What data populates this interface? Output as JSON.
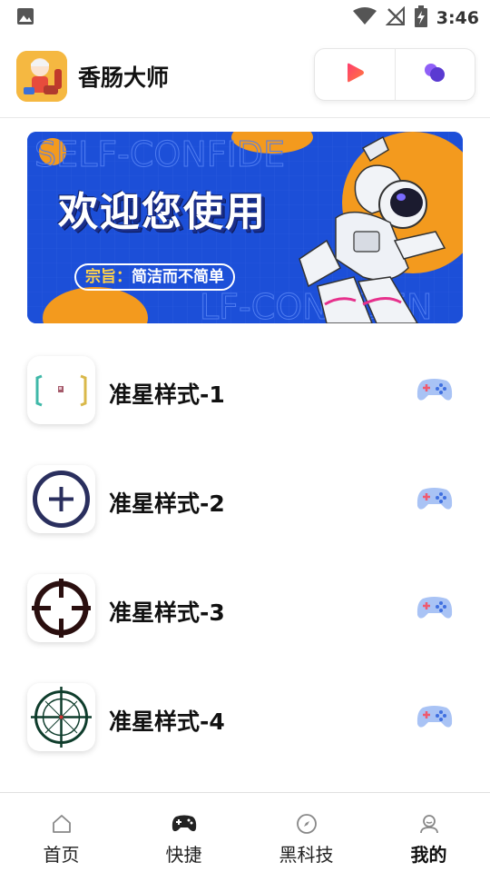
{
  "status_bar": {
    "time": "3:46",
    "icons": [
      "gallery-icon",
      "wifi-icon",
      "no-signal-icon",
      "battery-charging-icon"
    ]
  },
  "header": {
    "app_name": "香肠大师",
    "capsule_buttons": [
      "play-icon",
      "bubbles-icon"
    ]
  },
  "banner": {
    "title": "欢迎您使用",
    "subtitle_key": "宗旨：",
    "subtitle_value": "简洁而不简单",
    "background_text": "SELF-CONFIDENT",
    "colors": {
      "background": "#1c4fd8",
      "accent": "#f39a1e"
    }
  },
  "list": {
    "items": [
      {
        "label": "准星样式-1",
        "icon": "bracket-crosshair-icon"
      },
      {
        "label": "准星样式-2",
        "icon": "circle-plus-crosshair-icon"
      },
      {
        "label": "准星样式-3",
        "icon": "circle-scope-crosshair-icon"
      },
      {
        "label": "准星样式-4",
        "icon": "sniper-crosshair-icon"
      }
    ],
    "action_icon": "gamepad-icon"
  },
  "bottom_nav": {
    "items": [
      {
        "label": "首页",
        "icon": "home-icon",
        "active": false
      },
      {
        "label": "快捷",
        "icon": "gamepad-filled-icon",
        "active": false
      },
      {
        "label": "黑科技",
        "icon": "compass-icon",
        "active": false
      },
      {
        "label": "我的",
        "icon": "user-icon",
        "active": true
      }
    ]
  }
}
